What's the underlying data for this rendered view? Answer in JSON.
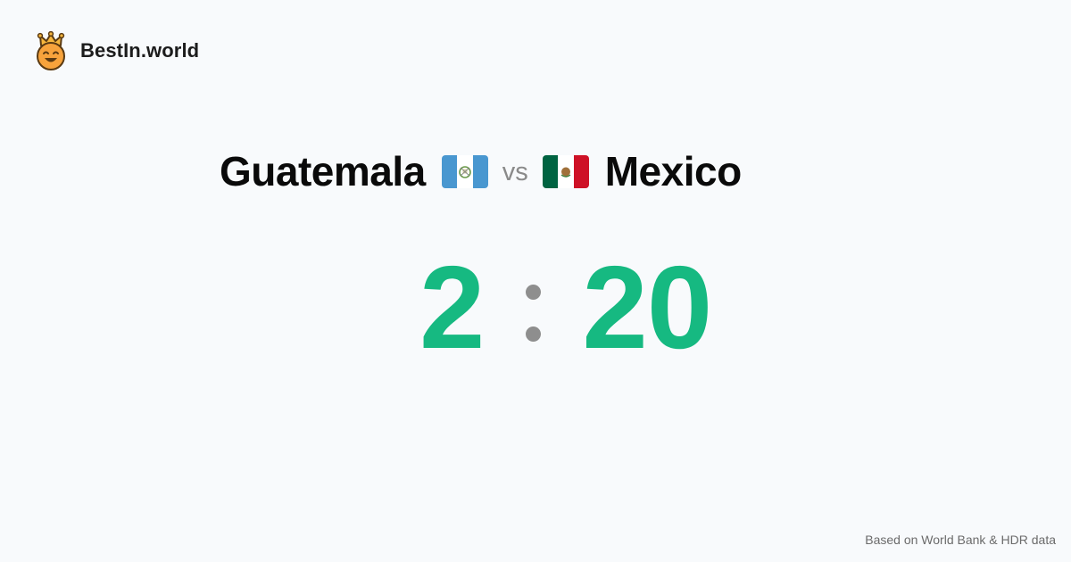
{
  "brand": {
    "name": "BestIn.world",
    "logo_icon": "crown-smiley-icon"
  },
  "comparison": {
    "country_a": {
      "name": "Guatemala",
      "flag_icon": "guatemala-flag-icon",
      "score": "2"
    },
    "separator": "vs",
    "country_b": {
      "name": "Mexico",
      "flag_icon": "mexico-flag-icon",
      "score": "20"
    }
  },
  "footer": {
    "source": "Based on World Bank & HDR data"
  },
  "colors": {
    "background": "#f8fafc",
    "score": "#16b981",
    "separator": "#8e8e8e",
    "text": "#0a0a0a"
  }
}
